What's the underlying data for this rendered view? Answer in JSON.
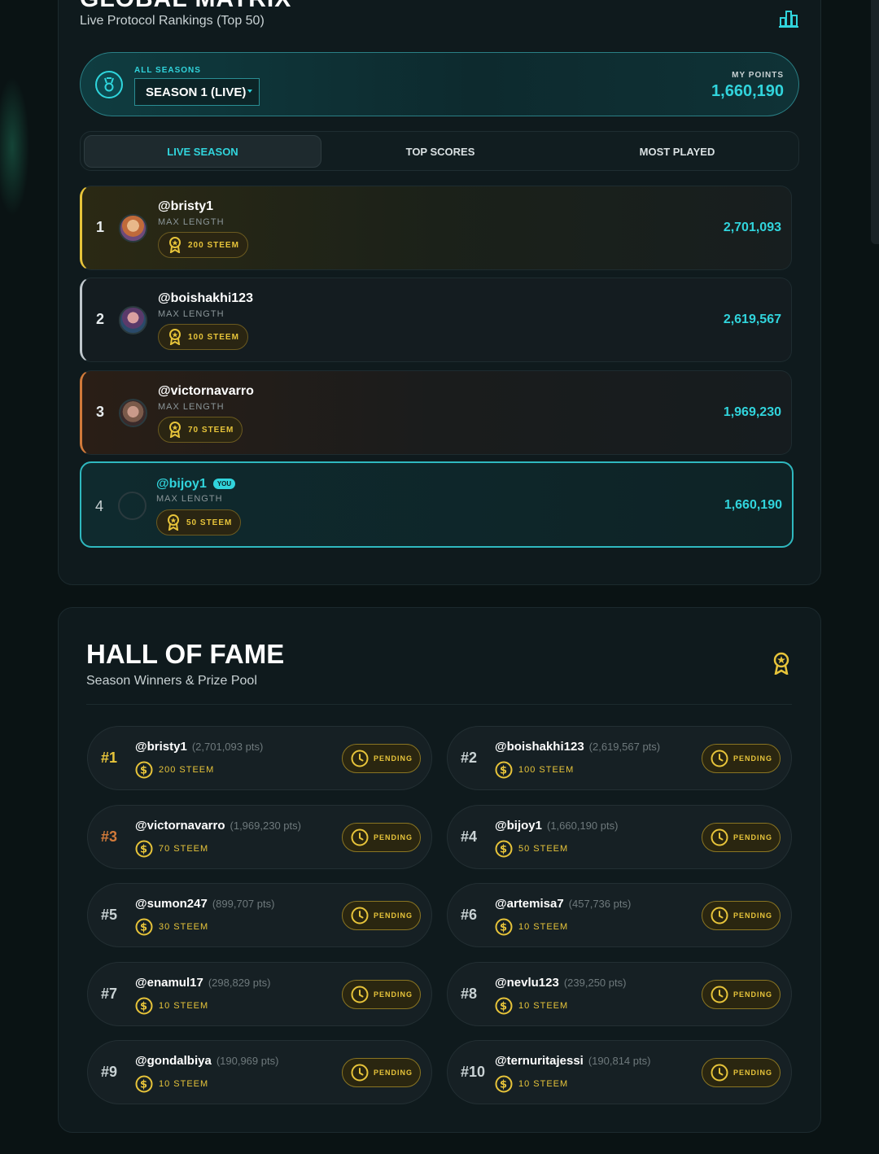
{
  "global_matrix": {
    "title": "GLOBAL MATRIX",
    "subtitle": "Live Protocol Rankings (Top 50)",
    "chart_icon": "bar-chart-icon"
  },
  "season": {
    "all_seasons_label": "ALL SEASONS",
    "selected": "SEASON 1 (LIVE)",
    "my_points_label": "MY POINTS",
    "my_points": "1,660,190"
  },
  "tabs": [
    {
      "label": "LIVE SEASON",
      "active": true
    },
    {
      "label": "TOP SCORES",
      "active": false
    },
    {
      "label": "MOST PLAYED",
      "active": false
    }
  ],
  "rankings": [
    {
      "rank": "1",
      "user": "@bristy1",
      "mode": "MAX LENGTH",
      "prize": "200 STEEM",
      "score": "2,701,093"
    },
    {
      "rank": "2",
      "user": "@boishakhi123",
      "mode": "MAX LENGTH",
      "prize": "100 STEEM",
      "score": "2,619,567"
    },
    {
      "rank": "3",
      "user": "@victornavarro",
      "mode": "MAX LENGTH",
      "prize": "70 STEEM",
      "score": "1,969,230"
    },
    {
      "rank": "4",
      "user": "@bijoy1",
      "you_badge": "YOU",
      "mode": "MAX LENGTH",
      "prize": "50 STEEM",
      "score": "1,660,190"
    }
  ],
  "hall_of_fame": {
    "title": "HALL OF FAME",
    "subtitle": "Season Winners & Prize Pool",
    "winners": [
      {
        "rank": "#1",
        "user": "@bristy1",
        "pts": "(2,701,093 pts)",
        "prize": "200 STEEM",
        "status": "PENDING"
      },
      {
        "rank": "#2",
        "user": "@boishakhi123",
        "pts": "(2,619,567 pts)",
        "prize": "100 STEEM",
        "status": "PENDING"
      },
      {
        "rank": "#3",
        "user": "@victornavarro",
        "pts": "(1,969,230 pts)",
        "prize": "70 STEEM",
        "status": "PENDING"
      },
      {
        "rank": "#4",
        "user": "@bijoy1",
        "pts": "(1,660,190 pts)",
        "prize": "50 STEEM",
        "status": "PENDING"
      },
      {
        "rank": "#5",
        "user": "@sumon247",
        "pts": "(899,707 pts)",
        "prize": "30 STEEM",
        "status": "PENDING"
      },
      {
        "rank": "#6",
        "user": "@artemisa7",
        "pts": "(457,736 pts)",
        "prize": "10 STEEM",
        "status": "PENDING"
      },
      {
        "rank": "#7",
        "user": "@enamul17",
        "pts": "(298,829 pts)",
        "prize": "10 STEEM",
        "status": "PENDING"
      },
      {
        "rank": "#8",
        "user": "@nevlu123",
        "pts": "(239,250 pts)",
        "prize": "10 STEEM",
        "status": "PENDING"
      },
      {
        "rank": "#9",
        "user": "@gondalbiya",
        "pts": "(190,969 pts)",
        "prize": "10 STEEM",
        "status": "PENDING"
      },
      {
        "rank": "#10",
        "user": "@ternuritajessi",
        "pts": "(190,814 pts)",
        "prize": "10 STEEM",
        "status": "PENDING"
      }
    ]
  },
  "colors": {
    "accent": "#31d4dc",
    "gold": "#e7c43a",
    "bronze": "#d27a3a",
    "background": "#0a1314"
  }
}
